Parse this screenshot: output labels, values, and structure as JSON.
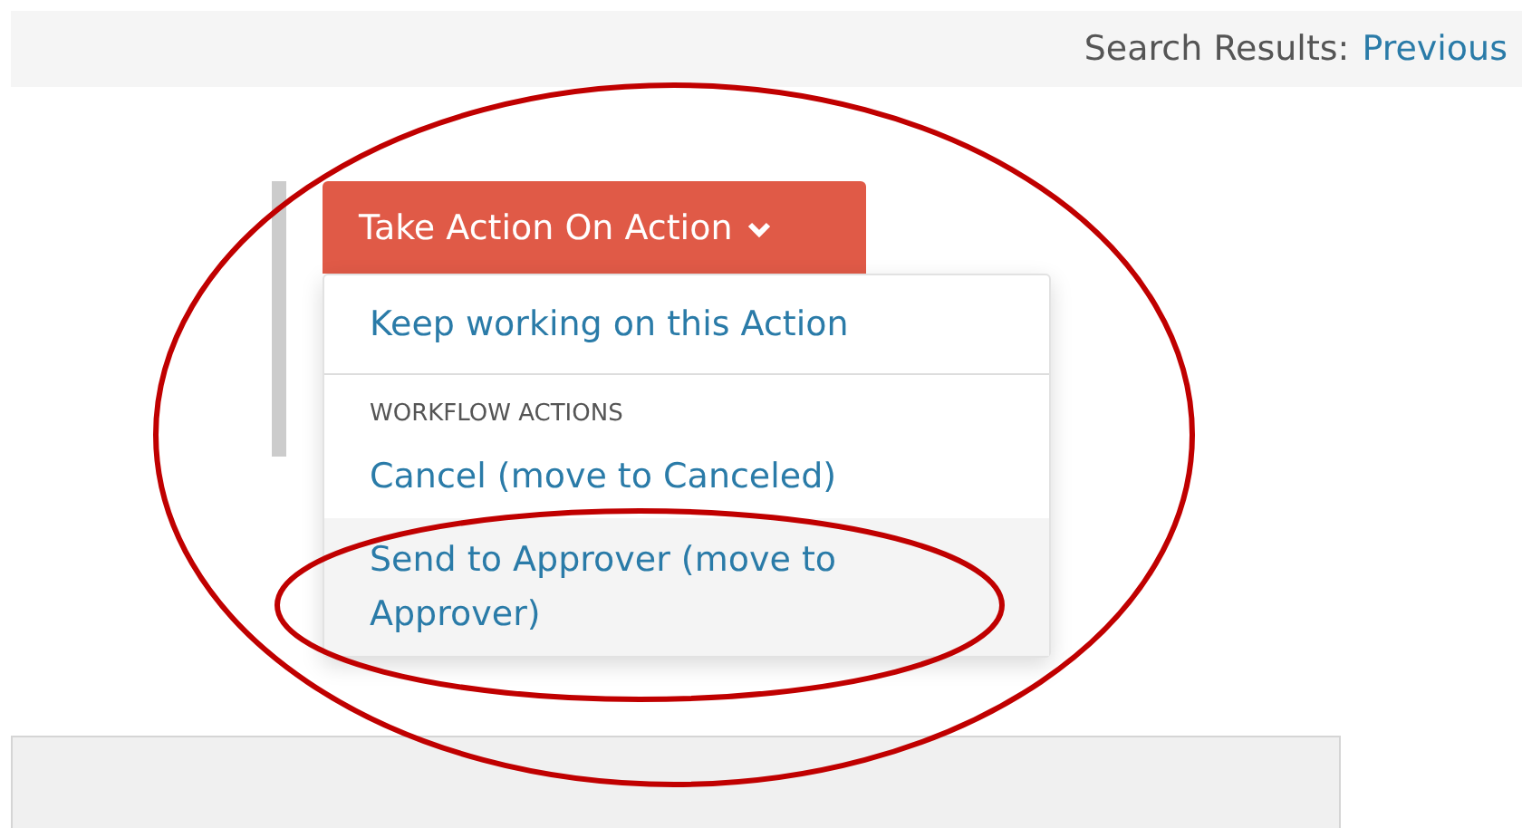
{
  "top_bar": {
    "label": "Search Results:",
    "link": "Previous"
  },
  "action_button": {
    "label": "Take Action On Action",
    "expanded": true
  },
  "menu": {
    "items": [
      {
        "kind": "link",
        "label": "Keep working on this Action",
        "highlighted": false
      },
      {
        "kind": "divider"
      },
      {
        "kind": "header",
        "label": "WORKFLOW ACTIONS"
      },
      {
        "kind": "link",
        "label": "Cancel (move to Canceled)",
        "highlighted": false
      },
      {
        "kind": "link",
        "label": "Send to Approver (move to Approver)",
        "highlighted": true
      }
    ]
  }
}
